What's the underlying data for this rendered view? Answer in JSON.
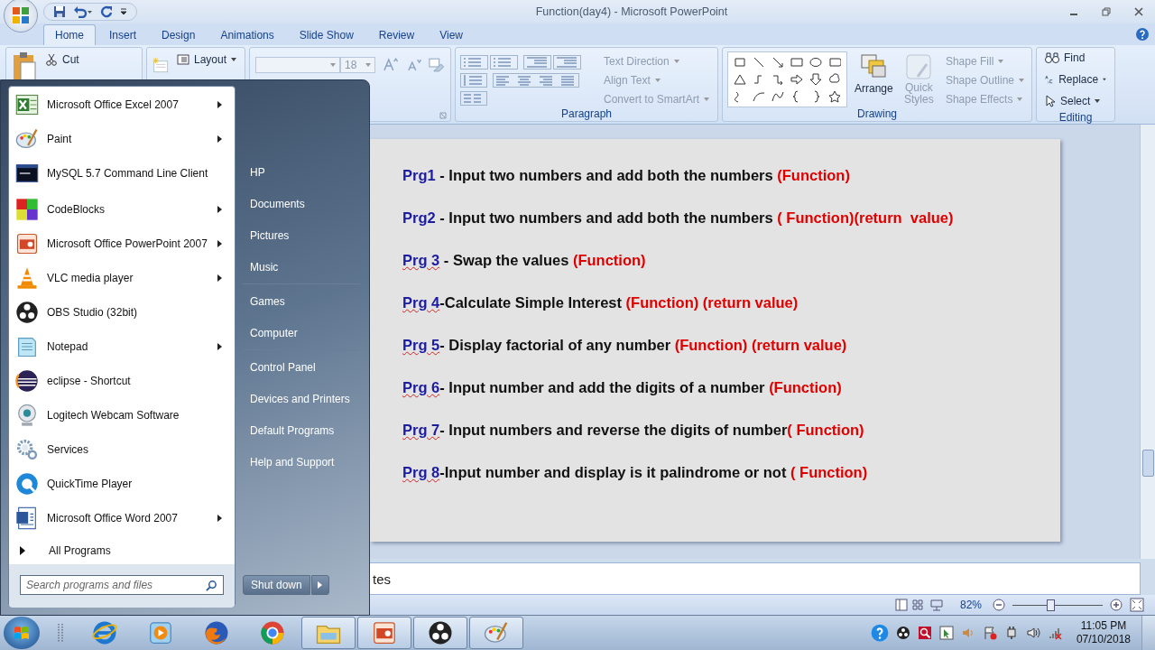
{
  "window": {
    "title": "Function(day4) - Microsoft PowerPoint"
  },
  "tabs": [
    {
      "label": "Home",
      "selected": true
    },
    {
      "label": "Insert",
      "selected": false
    },
    {
      "label": "Design",
      "selected": false
    },
    {
      "label": "Animations",
      "selected": false
    },
    {
      "label": "Slide Show",
      "selected": false
    },
    {
      "label": "Review",
      "selected": false
    },
    {
      "label": "View",
      "selected": false
    }
  ],
  "ribbon": {
    "clipboard": {
      "cut": "Cut"
    },
    "slides": {
      "layout": "Layout"
    },
    "font": {
      "size": "18"
    },
    "paragraph": {
      "label": "Paragraph",
      "commands": [
        {
          "label": "Text Direction",
          "disabled": true,
          "dropdown": true
        },
        {
          "label": "Align Text",
          "disabled": true,
          "dropdown": true
        },
        {
          "label": "Convert to SmartArt",
          "disabled": true,
          "dropdown": true
        }
      ]
    },
    "drawing": {
      "label": "Drawing",
      "arrange": "Arrange",
      "quick_styles": {
        "label": "Quick Styles",
        "disabled": true
      },
      "commands": [
        {
          "label": "Shape Fill",
          "disabled": true,
          "dropdown": true
        },
        {
          "label": "Shape Outline",
          "disabled": true,
          "dropdown": true
        },
        {
          "label": "Shape Effects",
          "disabled": true,
          "dropdown": true
        }
      ]
    },
    "editing": {
      "label": "Editing",
      "commands": [
        {
          "label": "Find",
          "disabled": false,
          "dropdown": false
        },
        {
          "label": "Replace",
          "disabled": false,
          "dropdown": true
        },
        {
          "label": "Select",
          "disabled": false,
          "dropdown": true
        }
      ]
    }
  },
  "slide": {
    "lines": [
      {
        "label": "Prg1",
        "spell_flag": false,
        "text": " - Input two numbers and add both the numbers ",
        "tag": "(Function)"
      },
      {
        "label": "Prg2",
        "spell_flag": false,
        "text": " - Input two numbers and add both the numbers ",
        "tag": "( Function)(return  value)"
      },
      {
        "label": "Prg 3",
        "spell_flag": true,
        "text": " - Swap the values ",
        "tag": "(Function)"
      },
      {
        "label": "Prg 4",
        "spell_flag": true,
        "text": "-Calculate Simple Interest ",
        "tag": "(Function) (return value)"
      },
      {
        "label": "Prg 5",
        "spell_flag": true,
        "text": "- Display factorial of any number ",
        "tag": "(Function) (return value)"
      },
      {
        "label": "Prg 6",
        "spell_flag": true,
        "text": "- Input number and add the digits of a number ",
        "tag": "(Function)"
      },
      {
        "label": "Prg 7",
        "spell_flag": true,
        "text": "- Input numbers and reverse the digits of number",
        "tag": "( Function)"
      },
      {
        "label": "Prg 8",
        "spell_flag": true,
        "text": "-Input number and display is it palindrome or not ",
        "tag": "( Function)"
      }
    ]
  },
  "notes": {
    "text": "tes"
  },
  "status_bar": {
    "zoom": "82%",
    "zoom_slider": {
      "level": 0.42
    }
  },
  "start_menu": {
    "pinned": [
      {
        "label": "Microsoft Office Excel 2007",
        "submenu": true
      },
      {
        "label": "Paint",
        "submenu": true
      },
      {
        "label": "MySQL 5.7 Command Line Client",
        "submenu": false
      }
    ],
    "recent": [
      {
        "label": "CodeBlocks",
        "submenu": true
      },
      {
        "label": "Microsoft Office PowerPoint 2007",
        "submenu": true
      },
      {
        "label": "VLC media player",
        "submenu": true
      },
      {
        "label": "OBS Studio (32bit)",
        "submenu": false
      },
      {
        "label": "Notepad",
        "submenu": true
      },
      {
        "label": "eclipse - Shortcut",
        "submenu": false
      },
      {
        "label": "Logitech Webcam Software",
        "submenu": false
      },
      {
        "label": "Services",
        "submenu": false
      },
      {
        "label": "QuickTime Player",
        "submenu": false
      },
      {
        "label": "Microsoft Office Word 2007",
        "submenu": true
      }
    ],
    "all_programs": "All Programs",
    "search": {
      "placeholder": "Search programs and files"
    },
    "places": [
      [
        "HP",
        "Documents",
        "Pictures",
        "Music"
      ],
      [
        "Games",
        "Computer"
      ],
      [
        "Control Panel",
        "Devices and Printers",
        "Default Programs",
        "Help and Support"
      ]
    ],
    "shutdown": "Shut down"
  },
  "taskbar": {
    "apps": [
      {
        "running": false
      },
      {
        "running": false
      },
      {
        "running": false
      },
      {
        "running": false
      },
      {
        "running": true
      },
      {
        "running": true
      },
      {
        "running": true
      },
      {
        "running": true
      }
    ],
    "clock": {
      "time": "11:05 PM",
      "date": "07/10/2018"
    }
  }
}
